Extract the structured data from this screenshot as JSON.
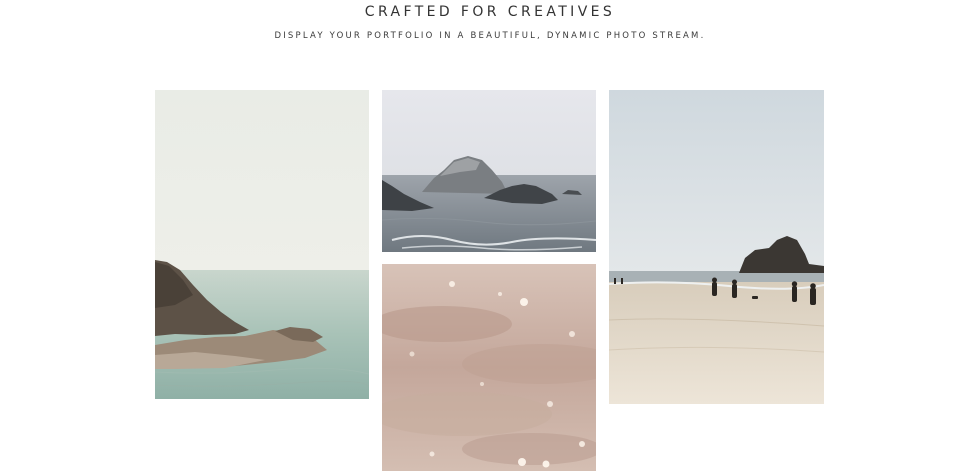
{
  "header": {
    "title": "CRAFTED FOR CREATIVES",
    "subtitle": "DISPLAY YOUR PORTFOLIO IN A BEAUTIFUL, DYNAMIC PHOTO STREAM."
  },
  "gallery": {
    "photos": [
      {
        "name": "coastal rocks and calm sea"
      },
      {
        "name": "sea stacks in misty ocean"
      },
      {
        "name": "people walking on sandy beach"
      },
      {
        "name": "sparkling sand closeup"
      }
    ]
  },
  "colors": {
    "text": "#333333",
    "background": "#ffffff"
  }
}
